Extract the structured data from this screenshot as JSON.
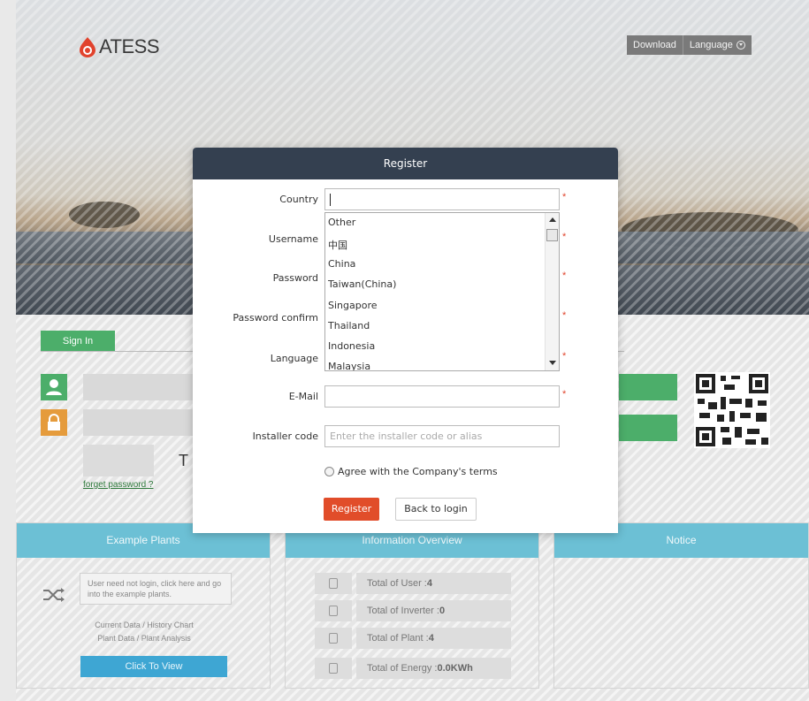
{
  "brand": {
    "logo_text": "ATESS"
  },
  "topnav": {
    "download_label": "Download",
    "language_label": "Language"
  },
  "signin": {
    "tab_label": "Sign In",
    "captcha_char": "T",
    "forget_label": "forget password ?"
  },
  "sections": {
    "example": {
      "title": "Example Plants",
      "note": "User need not login, click here and go into the example plants.",
      "line1": "Current Data / History Chart",
      "line2": "Plant Data / Plant Analysis",
      "button_label": "Click To View"
    },
    "info": {
      "title": "Information Overview",
      "rows": [
        {
          "label": "Total of User :",
          "value": "4"
        },
        {
          "label": "Total of Inverter :",
          "value": "0"
        },
        {
          "label": "Total of Plant :",
          "value": "4"
        },
        {
          "label": "Total of Energy :",
          "value": "0.0KWh"
        }
      ]
    },
    "notice": {
      "title": "Notice"
    }
  },
  "modal": {
    "title": "Register",
    "labels": {
      "country": "Country",
      "username": "Username",
      "password": "Password",
      "password_confirm": "Password confirm",
      "language": "Language",
      "email": "E-Mail",
      "installer": "Installer code"
    },
    "required_mark": "*",
    "country_value": "",
    "country_options": [
      "Other",
      "中国",
      "China",
      "Taiwan(China)",
      "Singapore",
      "Thailand",
      "Indonesia",
      "Malaysia"
    ],
    "email_value": "",
    "installer_value": "",
    "installer_placeholder": "Enter the installer code or alias",
    "agree_label": "Agree with the Company's terms",
    "register_label": "Register",
    "back_label": "Back to login"
  },
  "colors": {
    "modal_header": "#344050",
    "register_button": "#e14d2a",
    "signin_green": "#4cae6a",
    "lock_orange": "#e59b3c",
    "section_header": "#6cc0d5",
    "view_button": "#3ea6d3"
  },
  "icons": {
    "logo": "flame-logo-icon",
    "language": "circle-down-icon",
    "user": "user-icon",
    "lock": "lock-icon",
    "shuffle": "shuffle-icon",
    "qr": "qr-code-icon"
  }
}
